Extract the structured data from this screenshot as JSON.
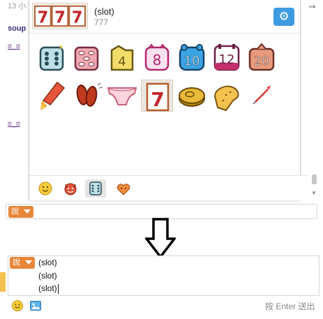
{
  "background": {
    "time_text": "13 小",
    "username": "soup",
    "emote_text_1": "ಠ_ಠ",
    "emote_text_2": "ಠ_ಠ",
    "chevron": "⌄"
  },
  "popup": {
    "preview": {
      "name": "(slot)",
      "code": "777",
      "icon": "slot-777-icon"
    },
    "settings_button": "gear-icon",
    "emotes": [
      {
        "id": "dice",
        "icon": "dice-icon"
      },
      {
        "id": "dice-pink",
        "icon": "dice-eyes-icon"
      },
      {
        "id": "num4",
        "icon": "number-4-icon",
        "text": "4"
      },
      {
        "id": "num8",
        "icon": "number-8-icon",
        "text": "8"
      },
      {
        "id": "num10",
        "icon": "number-10-icon",
        "text": "10"
      },
      {
        "id": "num12",
        "icon": "number-12-icon",
        "text": "12"
      },
      {
        "id": "num20",
        "icon": "number-20-icon",
        "text": "20"
      },
      {
        "id": "rocket",
        "icon": "rocket-icon"
      },
      {
        "id": "sausage",
        "icon": "sausage-icon"
      },
      {
        "id": "panties",
        "icon": "panties-icon"
      },
      {
        "id": "slot",
        "icon": "slot-7-icon",
        "text": "7",
        "selected": true
      },
      {
        "id": "coin",
        "icon": "coin-icon"
      },
      {
        "id": "bread",
        "icon": "bread-icon"
      },
      {
        "id": "dart",
        "icon": "dart-icon"
      }
    ],
    "footer_tabs": [
      {
        "id": "smiley",
        "icon": "smiley-icon"
      },
      {
        "id": "devil",
        "icon": "devil-icon"
      },
      {
        "id": "dice",
        "icon": "dice-tab-icon",
        "active": true
      },
      {
        "id": "heart",
        "icon": "heart-face-icon"
      }
    ]
  },
  "input_top": {
    "mode_label": "說",
    "value": ""
  },
  "arrow": "down-arrow-icon",
  "input_bottom": {
    "mode_label": "說",
    "lines": [
      "(slot)",
      "(slot)",
      "(slot)"
    ],
    "send_hint": "按 Enter 送出"
  },
  "colors": {
    "accent_orange": "#e8873a",
    "settings_blue": "#3d9be0"
  }
}
